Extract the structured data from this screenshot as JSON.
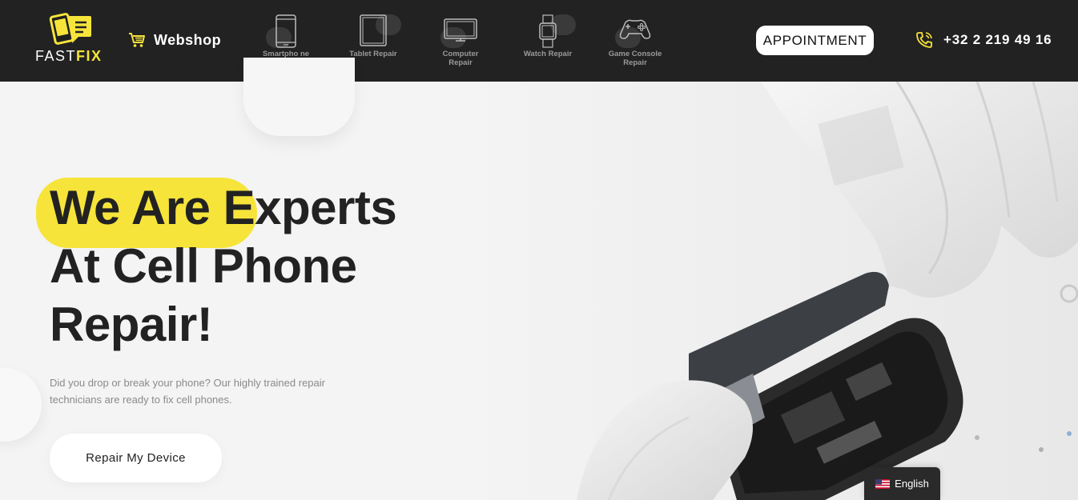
{
  "header": {
    "logo": {
      "text_main": "FAST",
      "text_accent": "FIX"
    },
    "webshop_label": "Webshop",
    "nav": [
      {
        "label": "Smartpho ne Repair",
        "icon": "smartphone-icon"
      },
      {
        "label": "Tablet Repair",
        "icon": "tablet-icon"
      },
      {
        "label": "Computer Repair",
        "icon": "computer-icon"
      },
      {
        "label": "Watch Repair",
        "icon": "watch-icon"
      },
      {
        "label": "Game Console Repair",
        "icon": "gamepad-icon"
      }
    ],
    "appointment_label": "APPOINTMENT",
    "phone_number": "+32 2 219 49 16"
  },
  "hero": {
    "headline_line1_highlight": "We Are",
    "headline_line1_rest": " Experts",
    "headline_line2": "At Cell Phone",
    "headline_line3": "Repair!",
    "description": "Did you drop or break your phone? Our highly trained repair technicians are ready to fix cell phones.",
    "cta_label": "Repair My Device"
  },
  "language": {
    "label": "English",
    "flag": "us-flag-icon"
  },
  "colors": {
    "accent": "#f6e43a",
    "header_bg": "#222222",
    "text_dark": "#222222"
  }
}
